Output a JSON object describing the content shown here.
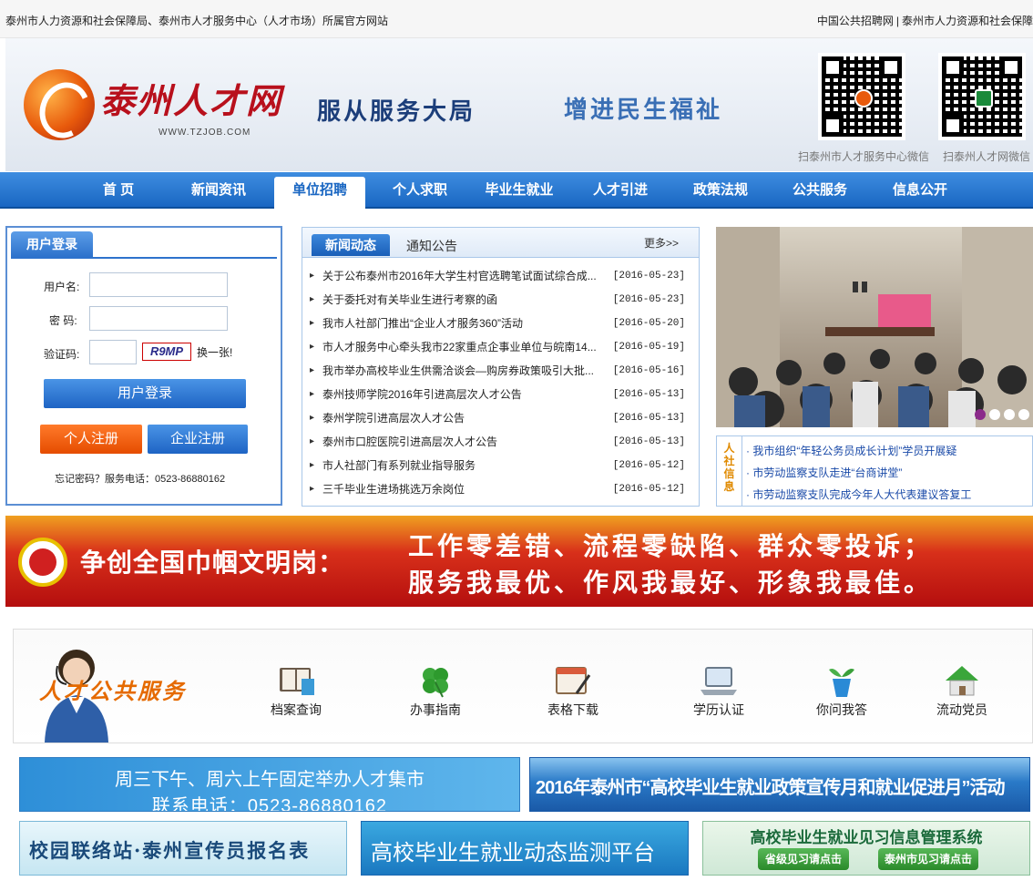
{
  "topbar": {
    "left": "泰州市人力资源和社会保障局、泰州市人才服务中心（人才市场）所属官方网站",
    "links": [
      "中国公共招聘网",
      "泰州市人力资源和社会保障"
    ]
  },
  "banner": {
    "logo_text": "泰州人才网",
    "logo_url": "WWW.TZJOB.COM",
    "slogan1": "服从服务大局",
    "slogan2": "增进民生福祉",
    "qr1_caption": "扫泰州市人才服务中心微信",
    "qr2_caption": "扫泰州人才网微信"
  },
  "nav": [
    "首 页",
    "新闻资讯",
    "单位招聘",
    "个人求职",
    "毕业生就业",
    "人才引进",
    "政策法规",
    "公共服务",
    "信息公开"
  ],
  "login": {
    "title": "用户登录",
    "username_label": "用户名:",
    "password_label": "密 码:",
    "captcha_label": "验证码:",
    "captcha_value": "R9MP",
    "refresh": "换一张!",
    "login_btn": "用户登录",
    "personal_btn": "个人注册",
    "company_btn": "企业注册",
    "forgot": "忘记密码？服务电话：0523-86880162"
  },
  "news": {
    "tab_active": "新闻动态",
    "tab_other": "通知公告",
    "more": "更多>>",
    "items": [
      {
        "title": "关于公布泰州市2016年大学生村官选聘笔试面试综合成...",
        "date": "[2016-05-23]"
      },
      {
        "title": "关于委托对有关毕业生进行考察的函",
        "date": "[2016-05-23]"
      },
      {
        "title": "我市人社部门推出“企业人才服务360”活动",
        "date": "[2016-05-20]"
      },
      {
        "title": "市人才服务中心牵头我市22家重点企事业单位与皖南14...",
        "date": "[2016-05-19]"
      },
      {
        "title": "我市举办高校毕业生供需洽谈会—购房券政策吸引大批...",
        "date": "[2016-05-16]"
      },
      {
        "title": "泰州技师学院2016年引进高层次人才公告",
        "date": "[2016-05-13]"
      },
      {
        "title": "泰州学院引进高层次人才公告",
        "date": "[2016-05-13]"
      },
      {
        "title": "泰州市口腔医院引进高层次人才公告",
        "date": "[2016-05-13]"
      },
      {
        "title": "市人社部门有系列就业指导服务",
        "date": "[2016-05-12]"
      },
      {
        "title": "三千毕业生进场挑选万余岗位",
        "date": "[2016-05-12]"
      }
    ]
  },
  "notice": {
    "side": "人社信息",
    "items": [
      "· 我市组织“年轻公务员成长计划”学员开展疑",
      "· 市劳动监察支队走进“台商讲堂”",
      "· 市劳动监察支队完成今年人大代表建议答复工"
    ]
  },
  "red_banner": {
    "line1": "争创全国巾帼文明岗：",
    "line2": "工作零差错、流程零缺陷、群众零投诉；",
    "line3": "服务我最优、作风我最好、形象我最佳。"
  },
  "services": {
    "title": "人才公共服务",
    "items": [
      {
        "label": "档案查询",
        "icon": "book-icon"
      },
      {
        "label": "办事指南",
        "icon": "clover-icon"
      },
      {
        "label": "表格下载",
        "icon": "calendar-pen-icon"
      },
      {
        "label": "学历认证",
        "icon": "laptop-icon"
      },
      {
        "label": "你问我答",
        "icon": "plant-pot-icon"
      },
      {
        "label": "流动党员",
        "icon": "house-icon"
      }
    ]
  },
  "bottom_banners": {
    "b1_line1": "周三下午、周六上午固定举办人才集市",
    "b1_line2": "联系电话：0523-86880162",
    "b2": "2016年泰州市“高校毕业生就业政策宣传月和就业促进月”活动",
    "b3": "校园联络站·泰州宣传员报名表",
    "b4": "高校毕业生就业动态监测平台",
    "b5_title": "高校毕业生就业见习信息管理系统",
    "b5_btn1": "省级见习请点击",
    "b5_btn2": "泰州市见习请点击"
  },
  "colors": {
    "nav_blue": "#1966c2",
    "orange": "#f05a0a",
    "accent_red": "#b8101c"
  }
}
